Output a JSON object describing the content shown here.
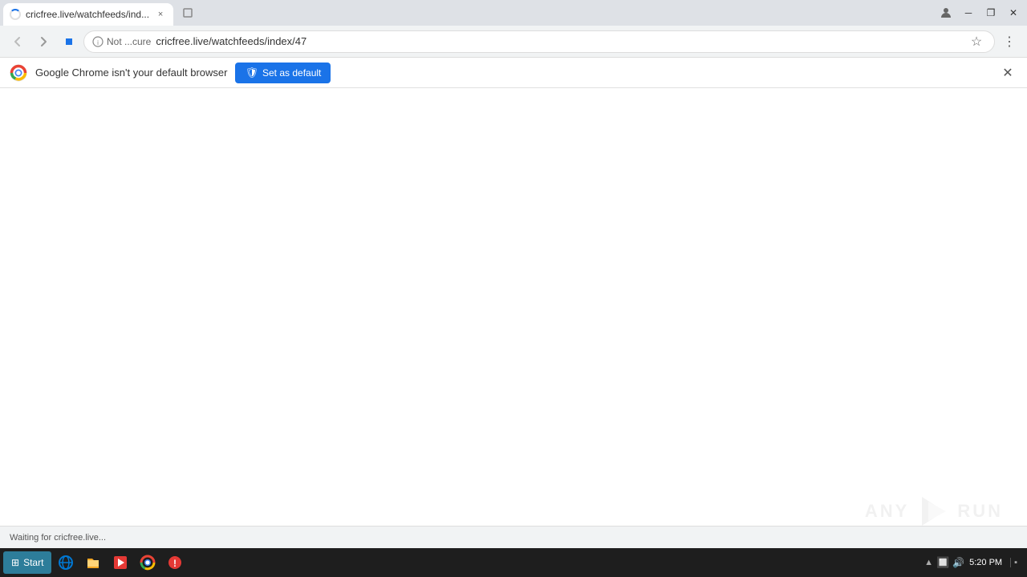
{
  "window": {
    "title": "cricfree.live/watchfeeds/ind... - Google Chrome"
  },
  "tab": {
    "title": "cricfree.live/watchfeeds/ind...",
    "close_label": "×",
    "new_tab_label": "+"
  },
  "window_controls": {
    "minimize": "─",
    "restore": "❐",
    "close": "✕"
  },
  "toolbar": {
    "back_label": "‹",
    "forward_label": "›",
    "reload_label": "✕",
    "security_text": "Not ...cure",
    "url": "cricfree.live/watchfeeds/index/47",
    "bookmark_label": "☆",
    "extensions_label": "⋮"
  },
  "info_bar": {
    "message": "Google Chrome isn't your default browser",
    "set_default_label": "Set as default",
    "close_label": "✕"
  },
  "status_bar": {
    "text": "Waiting for cricfree.live..."
  },
  "taskbar": {
    "start_label": "Start",
    "time": "5:20 PM",
    "items": [
      "IE",
      "Files",
      "Media",
      "Chrome",
      "Alert"
    ]
  },
  "watermark": {
    "text": "ANY",
    "subtext": "RUN"
  }
}
